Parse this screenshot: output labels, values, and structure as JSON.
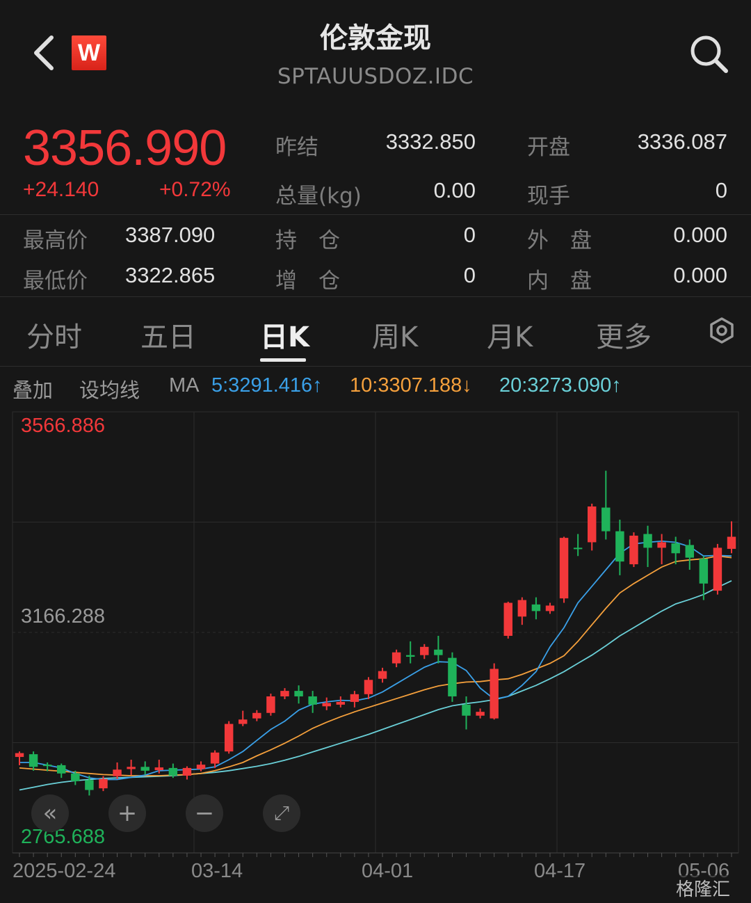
{
  "header": {
    "title": "伦敦金现",
    "code": "SPTAUUSDOZ.IDC",
    "logo_letter": "W"
  },
  "quote": {
    "price": "3356.990",
    "change": "+24.140",
    "change_pct": "+0.72%",
    "prev_close_label": "昨结",
    "prev_close": "3332.850",
    "open_label": "开盘",
    "open": "3336.087",
    "volume_label": "总量(kg)",
    "volume": "0.00",
    "turnover_label": "现手",
    "turnover": "0",
    "high_label": "最高价",
    "high": "3387.090",
    "low_label": "最低价",
    "low": "3322.865",
    "position_label": "持　仓",
    "position": "0",
    "add_position_label": "增　仓",
    "add_position": "0",
    "outer_label": "外　盘",
    "outer": "0.000",
    "inner_label": "内　盘",
    "inner": "0.000"
  },
  "tabs": [
    "分时",
    "五日",
    "日K",
    "周K",
    "月K",
    "更多"
  ],
  "active_tab": "日K",
  "indicator_bar": {
    "overlay": "叠加",
    "ma_setting": "设均线",
    "ma_label": "MA",
    "ma5": "5:3291.416↑",
    "ma10": "10:3307.188↓",
    "ma20": "20:3273.090↑"
  },
  "colors": {
    "up": "#f2383a",
    "down": "#1fb25a",
    "ma5": "#3aa0e8",
    "ma10": "#f5a03c",
    "ma20": "#6ad0d8"
  },
  "chart_data": {
    "type": "candlestick",
    "y_max_label": "3566.886",
    "y_mid_label": "3166.288",
    "y_min_label": "2765.688",
    "ylim": [
      2765.688,
      3566.886
    ],
    "dates_shown": [
      "2025-02-24",
      "03-14",
      "04-01",
      "04-17",
      "05-06"
    ],
    "candles": [
      [
        2940,
        2947,
        2925,
        2950
      ],
      [
        2945,
        2922,
        2915,
        2950
      ],
      [
        2926,
        2925,
        2914,
        2930
      ],
      [
        2925,
        2910,
        2902,
        2928
      ],
      [
        2910,
        2896,
        2889,
        2915
      ],
      [
        2898,
        2880,
        2870,
        2906
      ],
      [
        2883,
        2900,
        2878,
        2905
      ],
      [
        2905,
        2917,
        2900,
        2930
      ],
      [
        2918,
        2922,
        2907,
        2935
      ],
      [
        2922,
        2915,
        2908,
        2932
      ],
      [
        2916,
        2921,
        2910,
        2935
      ],
      [
        2920,
        2906,
        2902,
        2928
      ],
      [
        2906,
        2920,
        2899,
        2923
      ],
      [
        2918,
        2926,
        2914,
        2932
      ],
      [
        2928,
        2948,
        2920,
        2952
      ],
      [
        2950,
        3000,
        2946,
        3005
      ],
      [
        3000,
        3008,
        2996,
        3024
      ],
      [
        3010,
        3020,
        3005,
        3025
      ],
      [
        3020,
        3050,
        3015,
        3055
      ],
      [
        3050,
        3060,
        3045,
        3065
      ],
      [
        3060,
        3050,
        3037,
        3070
      ],
      [
        3050,
        3035,
        3020,
        3060
      ],
      [
        3032,
        3038,
        3025,
        3048
      ],
      [
        3035,
        3040,
        3030,
        3050
      ],
      [
        3040,
        3054,
        3030,
        3060
      ],
      [
        3054,
        3080,
        3045,
        3085
      ],
      [
        3082,
        3096,
        3075,
        3102
      ],
      [
        3110,
        3130,
        3103,
        3135
      ],
      [
        3125,
        3122,
        3110,
        3150
      ],
      [
        3125,
        3140,
        3118,
        3145
      ],
      [
        3135,
        3125,
        3110,
        3160
      ],
      [
        3120,
        3050,
        3040,
        3130
      ],
      [
        3035,
        3015,
        2990,
        3050
      ],
      [
        3015,
        3022,
        3010,
        3028
      ],
      [
        3010,
        3100,
        3008,
        3110
      ],
      [
        3160,
        3220,
        3155,
        3222
      ],
      [
        3195,
        3225,
        3180,
        3230
      ],
      [
        3217,
        3205,
        3190,
        3230
      ],
      [
        3205,
        3215,
        3200,
        3220
      ],
      [
        3228,
        3338,
        3220,
        3340
      ],
      [
        3320,
        3318,
        3305,
        3345
      ],
      [
        3330,
        3395,
        3315,
        3400
      ],
      [
        3393,
        3350,
        3335,
        3460
      ],
      [
        3350,
        3295,
        3270,
        3371
      ],
      [
        3290,
        3342,
        3285,
        3348
      ],
      [
        3345,
        3320,
        3285,
        3360
      ],
      [
        3320,
        3330,
        3290,
        3345
      ],
      [
        3328,
        3310,
        3290,
        3340
      ],
      [
        3325,
        3302,
        3280,
        3335
      ],
      [
        3300,
        3255,
        3225,
        3305
      ],
      [
        3242,
        3320,
        3235,
        3327
      ],
      [
        3318,
        3340,
        3310,
        3368
      ]
    ],
    "ma5": [
      2930,
      2930,
      2925,
      2920,
      2910,
      2902,
      2899,
      2899,
      2903,
      2907,
      2915,
      2916,
      2917,
      2918,
      2922,
      2935,
      2950,
      2970,
      2990,
      3005,
      3025,
      3036,
      3040,
      3043,
      3042,
      3047,
      3058,
      3073,
      3088,
      3103,
      3113,
      3112,
      3097,
      3065,
      3045,
      3050,
      3070,
      3095,
      3140,
      3175,
      3220,
      3250,
      3280,
      3310,
      3327,
      3330,
      3332,
      3330,
      3322,
      3305,
      3306,
      3305
    ],
    "ma10": [
      2920,
      2918,
      2916,
      2914,
      2912,
      2910,
      2908,
      2907,
      2906,
      2906,
      2906,
      2907,
      2908,
      2910,
      2915,
      2922,
      2930,
      2942,
      2953,
      2965,
      2978,
      2992,
      3003,
      3013,
      3022,
      3030,
      3038,
      3046,
      3054,
      3062,
      3069,
      3073,
      3076,
      3077,
      3080,
      3082,
      3090,
      3100,
      3110,
      3124,
      3150,
      3180,
      3210,
      3238,
      3255,
      3270,
      3285,
      3295,
      3298,
      3300,
      3305,
      3302
    ],
    "ma20": [
      2880,
      2885,
      2890,
      2894,
      2897,
      2899,
      2901,
      2902,
      2903,
      2904,
      2905,
      2906,
      2908,
      2910,
      2912,
      2915,
      2919,
      2923,
      2928,
      2934,
      2941,
      2949,
      2957,
      2965,
      2973,
      2981,
      2990,
      2999,
      3008,
      3017,
      3026,
      3033,
      3037,
      3040,
      3044,
      3050,
      3060,
      3070,
      3082,
      3095,
      3110,
      3125,
      3142,
      3160,
      3175,
      3190,
      3205,
      3218,
      3226,
      3235,
      3248,
      3260
    ]
  },
  "chart_controls": [
    "back-page",
    "zoom-in",
    "zoom-out",
    "fullscreen"
  ],
  "watermark": "格隆汇"
}
